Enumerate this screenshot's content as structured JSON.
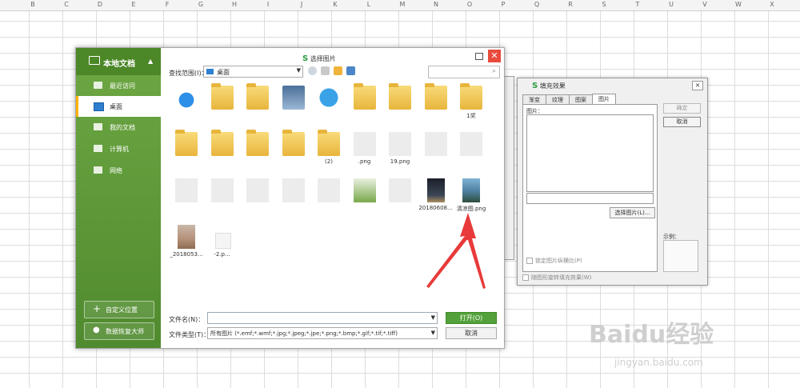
{
  "sheet": {
    "columns": [
      "B",
      "C",
      "D",
      "E",
      "F",
      "G",
      "H",
      "I",
      "J",
      "K",
      "L",
      "M",
      "N",
      "O",
      "P",
      "Q",
      "R",
      "S",
      "T",
      "U",
      "V",
      "W",
      "X"
    ]
  },
  "dialog": {
    "title": "选择图片",
    "sidebar": {
      "header": "本地文档",
      "items": [
        {
          "label": "最近访问",
          "icon": "recent-icon"
        },
        {
          "label": "桌面",
          "icon": "desktop-icon"
        },
        {
          "label": "我的文档",
          "icon": "folder-icon"
        },
        {
          "label": "计算机",
          "icon": "computer-icon"
        },
        {
          "label": "网络",
          "icon": "network-icon"
        }
      ],
      "custom_location": "自定义位置",
      "recovery": "数据恢复大师"
    },
    "look_in_label": "查找范围(I)：",
    "look_in_value": "桌面",
    "files": [
      {
        "name": "",
        "kind": "cloud"
      },
      {
        "name": "",
        "kind": "folder"
      },
      {
        "name": "",
        "kind": "folder-user"
      },
      {
        "name": "",
        "kind": "computer"
      },
      {
        "name": "",
        "kind": "network"
      },
      {
        "name": "",
        "kind": "folder"
      },
      {
        "name": "",
        "kind": "folder"
      },
      {
        "name": "",
        "kind": "folder"
      },
      {
        "name": "1奖",
        "kind": "folder"
      },
      {
        "name": "",
        "kind": "folder"
      },
      {
        "name": "",
        "kind": "folder"
      },
      {
        "name": "",
        "kind": "folder"
      },
      {
        "name": "",
        "kind": "folder"
      },
      {
        "name": "(2)",
        "kind": "folder"
      },
      {
        "name": ".png",
        "kind": "blur"
      },
      {
        "name": "19.png",
        "kind": "blur"
      },
      {
        "name": "",
        "kind": "blur"
      },
      {
        "name": "",
        "kind": "blur"
      },
      {
        "name": "",
        "kind": "blur"
      },
      {
        "name": "",
        "kind": "blur"
      },
      {
        "name": "",
        "kind": "blur"
      },
      {
        "name": "",
        "kind": "blur"
      },
      {
        "name": "",
        "kind": "blur"
      },
      {
        "name": "",
        "kind": "plant"
      },
      {
        "name": "",
        "kind": "blur"
      },
      {
        "name": "20180608...",
        "kind": "photo-dark"
      },
      {
        "name": "清凉图.png",
        "kind": "photo-landscape"
      },
      {
        "name": "_2018053...",
        "kind": "photo-desert"
      },
      {
        "name": "-2.p...",
        "kind": "small"
      }
    ],
    "filename_label": "文件名(N)：",
    "filename_value": "",
    "filetype_label": "文件类型(T)：",
    "filetype_value": "所有图片 (*.emf;*.wmf;*.jpg;*.jpeg;*.jpe;*.png;*.bmp;*.gif;*.tif;*.tiff)",
    "open_button": "打开(O)",
    "cancel_button": "取消"
  },
  "fill_dialog": {
    "title": "填充效果",
    "tabs": [
      "渐变",
      "纹理",
      "图案",
      "图片"
    ],
    "picture_label": "图片：",
    "select_picture": "选择图片(L)...",
    "lock_ratio": "锁定图片纵横比(P)",
    "rotate_with_shape": "随图形旋转填充效果(W)",
    "ok": "确定",
    "cancel": "取消",
    "sample": "示例："
  },
  "watermark": {
    "brand": "Baidu经验",
    "url": "jingyan.baidu.com"
  },
  "colors": {
    "sidebar": "#5f9a3a",
    "accent": "#53a13a",
    "close": "#e84b3c",
    "arrow": "#e83a3a"
  }
}
